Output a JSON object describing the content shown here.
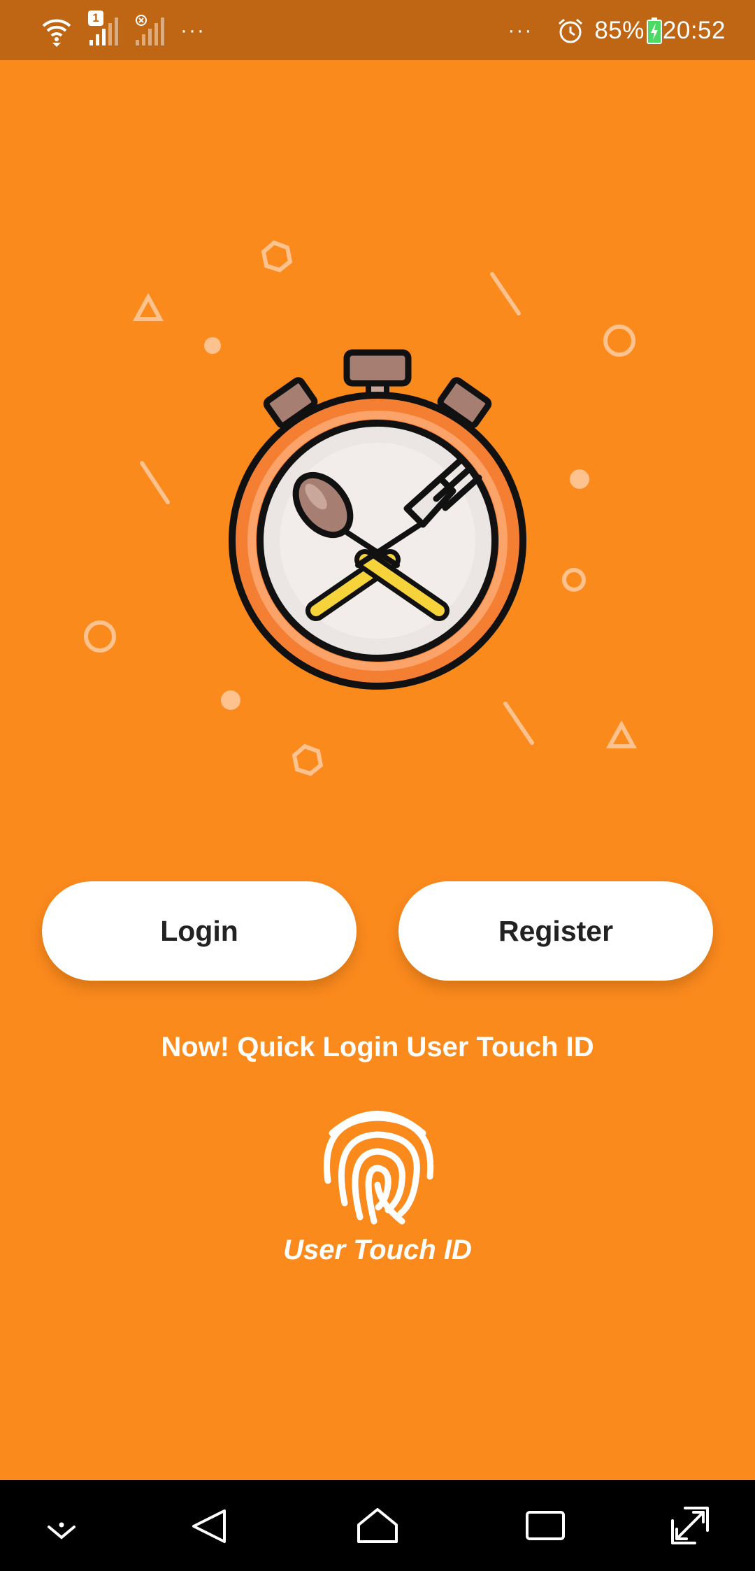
{
  "status_bar": {
    "sim1_badge": "1",
    "left_more": "···",
    "right_more": "···",
    "battery_percent": "85%",
    "time": "20:52",
    "icons": [
      "wifi-icon",
      "signal-sim1-icon",
      "signal-sim2-no-service-icon",
      "alarm-icon",
      "battery-charging-icon"
    ]
  },
  "hero": {
    "logo_icon": "stopwatch-plate-spoon-fork-icon",
    "decorations": [
      "hexagon",
      "triangle",
      "circle",
      "dot",
      "line"
    ]
  },
  "buttons": {
    "login_label": "Login",
    "register_label": "Register"
  },
  "quick_login": {
    "heading": "Now! Quick Login User Touch ID",
    "fingerprint_icon": "fingerprint-icon",
    "touch_label": "User Touch ID"
  },
  "nav_bar": {
    "icons": [
      "notification-pull-icon",
      "back-icon",
      "home-icon",
      "recents-icon",
      "expand-icon"
    ]
  },
  "colors": {
    "background": "#FB8A1D",
    "status_bar": "#BF6614",
    "button": "#FFFFFF",
    "button_text": "#222222",
    "nav_bar": "#000000"
  }
}
